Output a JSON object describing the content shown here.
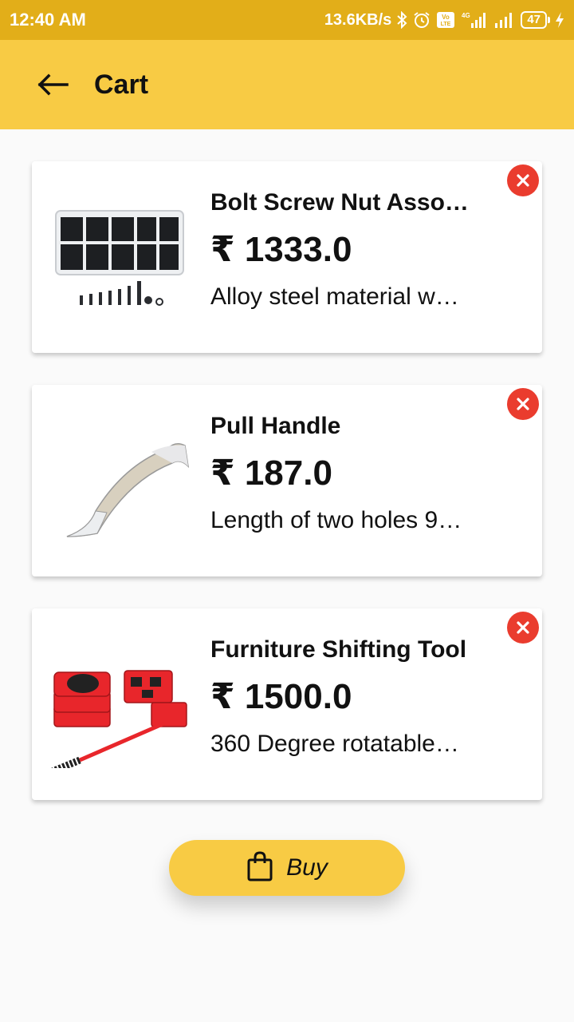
{
  "status_bar": {
    "time": "12:40 AM",
    "speed": "13.6KB/s",
    "battery": "47",
    "icons": [
      "bluetooth-icon",
      "alarm-icon",
      "volte-icon",
      "signal-4g-icon",
      "signal-icon",
      "battery-icon",
      "charging-icon"
    ]
  },
  "app_bar": {
    "title": "Cart",
    "back_icon": "arrow-left-icon"
  },
  "cart_items": [
    {
      "name": "Bolt Screw Nut Asso…",
      "price": "₹ 1333.0",
      "description": "Alloy steel material w…",
      "image": "bolt-screw-set-image"
    },
    {
      "name": "Pull Handle",
      "price": "₹ 187.0",
      "description": "Length of two holes 9…",
      "image": "pull-handle-image"
    },
    {
      "name": "Furniture Shifting Tool",
      "price": "₹ 1500.0",
      "description": "360 Degree rotatable…",
      "image": "furniture-shifting-tool-image"
    }
  ],
  "buy_button": {
    "label": "Buy",
    "icon": "shopping-bag-icon"
  },
  "colors": {
    "status_bar": "#e2ae19",
    "app_bar": "#f8cb44",
    "remove": "#ea3c2e",
    "background": "#fafafa"
  }
}
